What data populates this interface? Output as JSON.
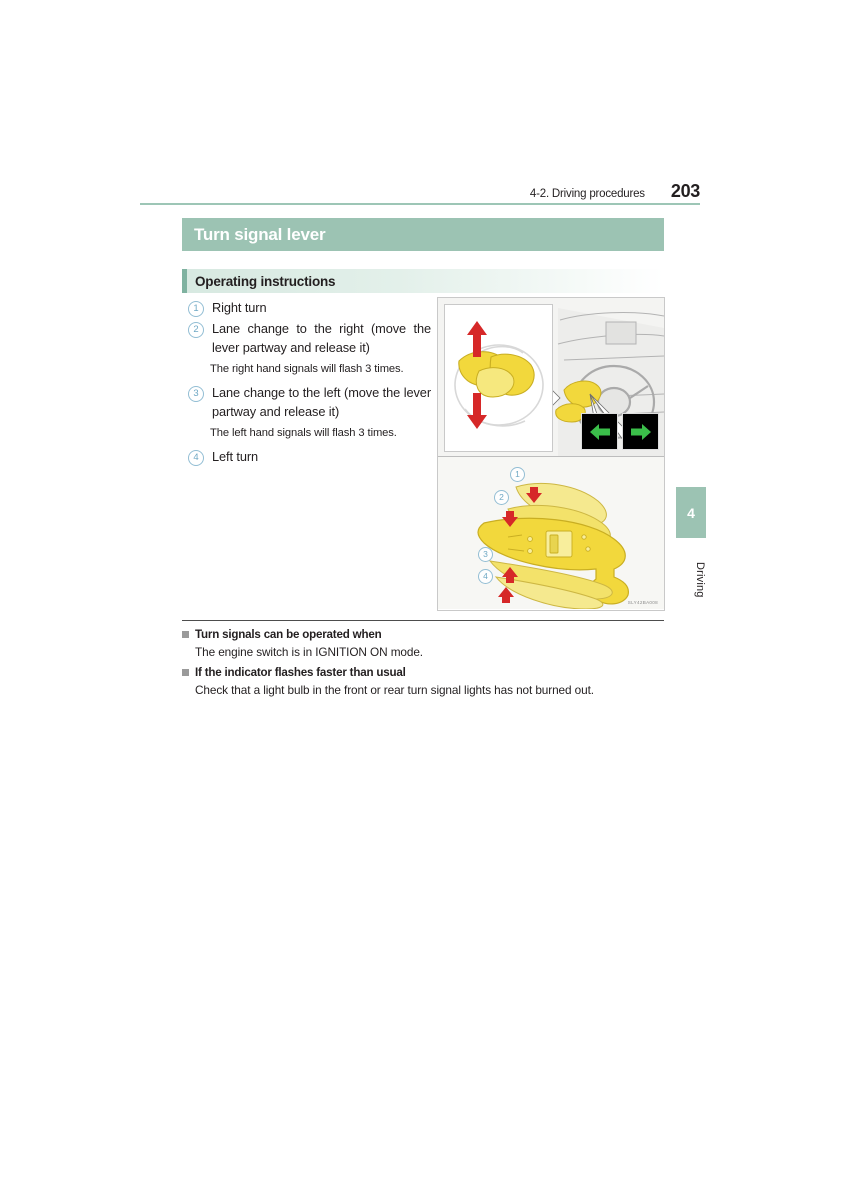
{
  "running_head": {
    "section": "4-2. Driving procedures",
    "page_number": "203"
  },
  "section": {
    "title": "Turn signal lever",
    "subheading": "Operating instructions"
  },
  "instructions": [
    {
      "number": "1",
      "text": "Right turn",
      "note": null
    },
    {
      "number": "2",
      "text": "Lane change to the right (move the lever partway and release it)",
      "note": "The right hand signals will flash 3 times."
    },
    {
      "number": "3",
      "text": "Lane change to the left (move the lever partway and release it)",
      "note": "The left hand signals will flash 3 times."
    },
    {
      "number": "4",
      "text": "Left turn",
      "note": null
    }
  ],
  "figure": {
    "code": "SLY42BA008",
    "callouts": [
      "1",
      "2",
      "3",
      "4"
    ],
    "indicators": [
      {
        "name": "left-turn-indicator",
        "glyph": "←",
        "color": "#3bbf4a"
      },
      {
        "name": "right-turn-indicator",
        "glyph": "→",
        "color": "#3bbf4a"
      }
    ],
    "lever_color": "#f2d83c",
    "arrow_color": "#d62828"
  },
  "notes": [
    {
      "heading": "Turn signals can be operated when",
      "body": "The engine switch is in IGNITION ON mode."
    },
    {
      "heading": "If the indicator flashes faster than usual",
      "body": "Check that a light bulb in the front or rear turn signal lights has not burned out."
    }
  ],
  "side_tab": {
    "chapter": "4",
    "label": "Driving"
  },
  "colors": {
    "accent_green": "#9cc3b3",
    "accent_dark_green": "#7fb2a0",
    "callout_blue": "#6fa8c4"
  }
}
